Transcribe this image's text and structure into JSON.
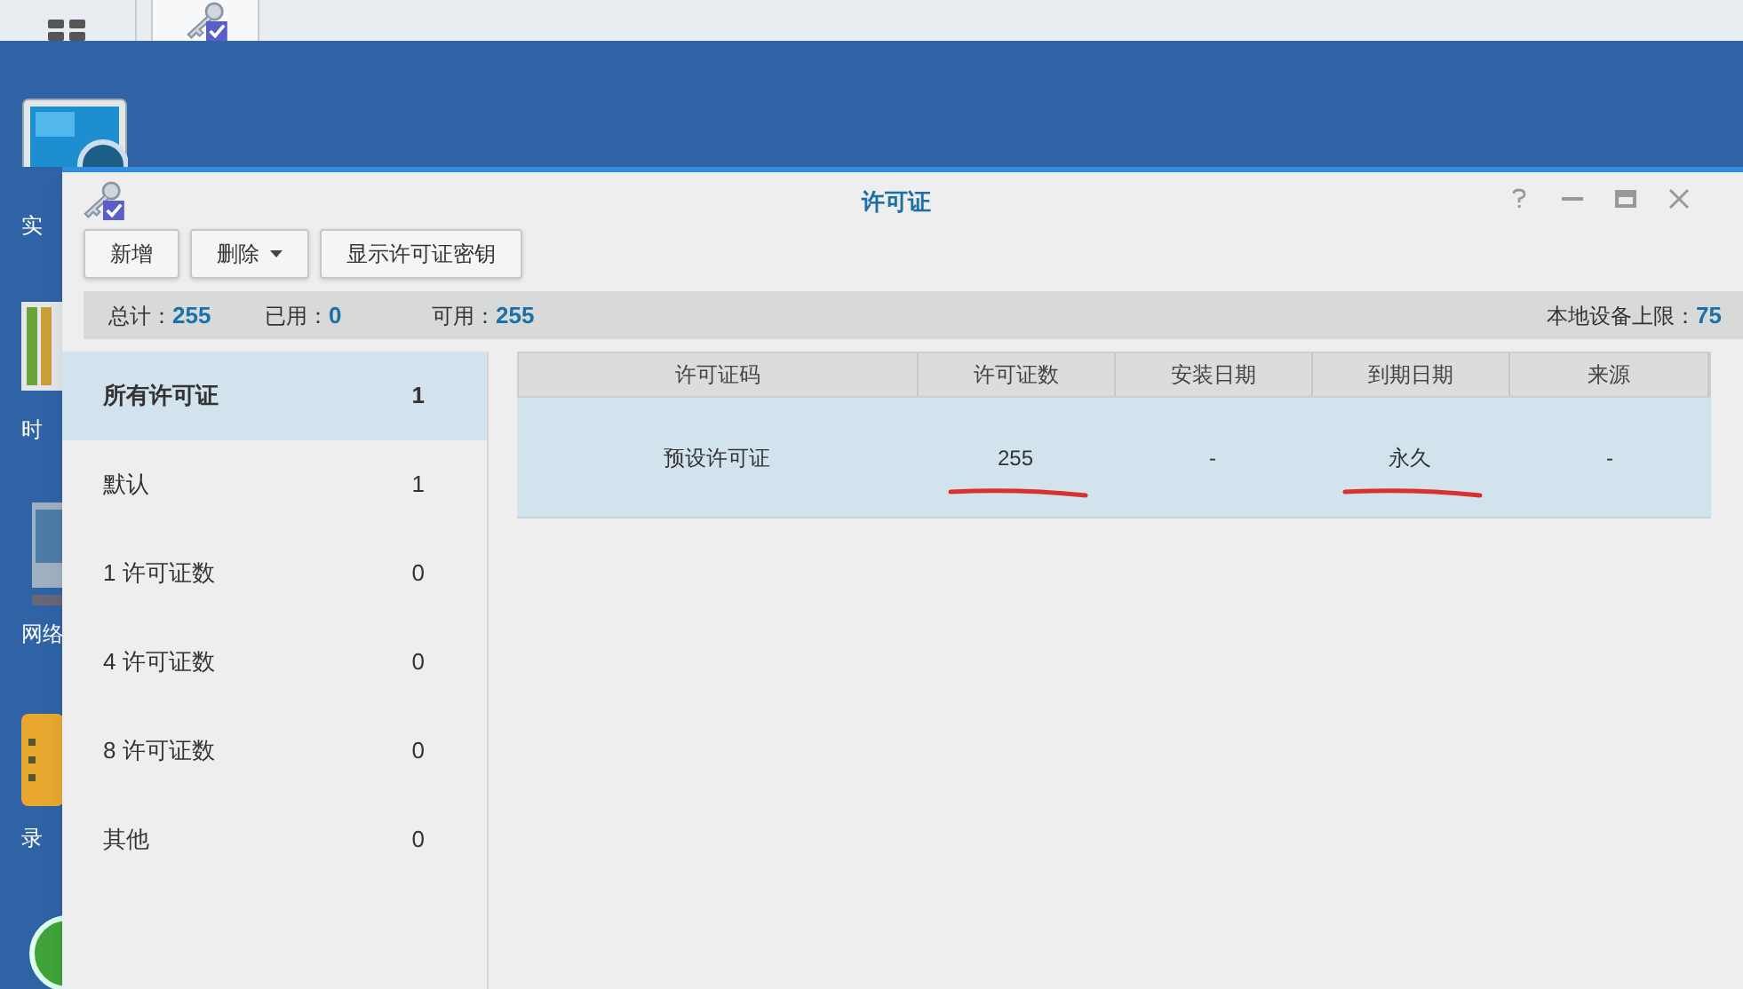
{
  "desktop_icons": [
    {
      "label": "实"
    },
    {
      "label": "时"
    },
    {
      "label": "网络"
    },
    {
      "label": "录"
    }
  ],
  "window": {
    "title": "许可证"
  },
  "toolbar": [
    {
      "label": "新增",
      "kind": "button"
    },
    {
      "label": "删除",
      "kind": "dropdown"
    },
    {
      "label": "显示许可证密钥",
      "kind": "button"
    }
  ],
  "stats": [
    {
      "label": "总计：",
      "value": "255"
    },
    {
      "label": "已用：",
      "value": "0"
    },
    {
      "label": "可用：",
      "value": "255"
    }
  ],
  "device_limit": {
    "label": "本地设备上限：",
    "value": "75"
  },
  "sidebar": {
    "items": [
      {
        "label": "所有许可证",
        "count": "1",
        "selected": true
      },
      {
        "label": "默认",
        "count": "1",
        "selected": false
      },
      {
        "label": "1 许可证数",
        "count": "0",
        "selected": false
      },
      {
        "label": "4 许可证数",
        "count": "0",
        "selected": false
      },
      {
        "label": "8 许可证数",
        "count": "0",
        "selected": false
      },
      {
        "label": "其他",
        "count": "0",
        "selected": false
      }
    ]
  },
  "table": {
    "columns": [
      "许可证码",
      "许可证数",
      "安装日期",
      "到期日期",
      "来源"
    ],
    "rows": [
      {
        "cells": [
          {
            "text": "预设许可证",
            "underlined": false
          },
          {
            "text": "255",
            "underlined": true
          },
          {
            "text": "-",
            "underlined": false
          },
          {
            "text": "永久",
            "underlined": true
          },
          {
            "text": "-",
            "underlined": false
          }
        ],
        "selected": true
      }
    ]
  }
}
